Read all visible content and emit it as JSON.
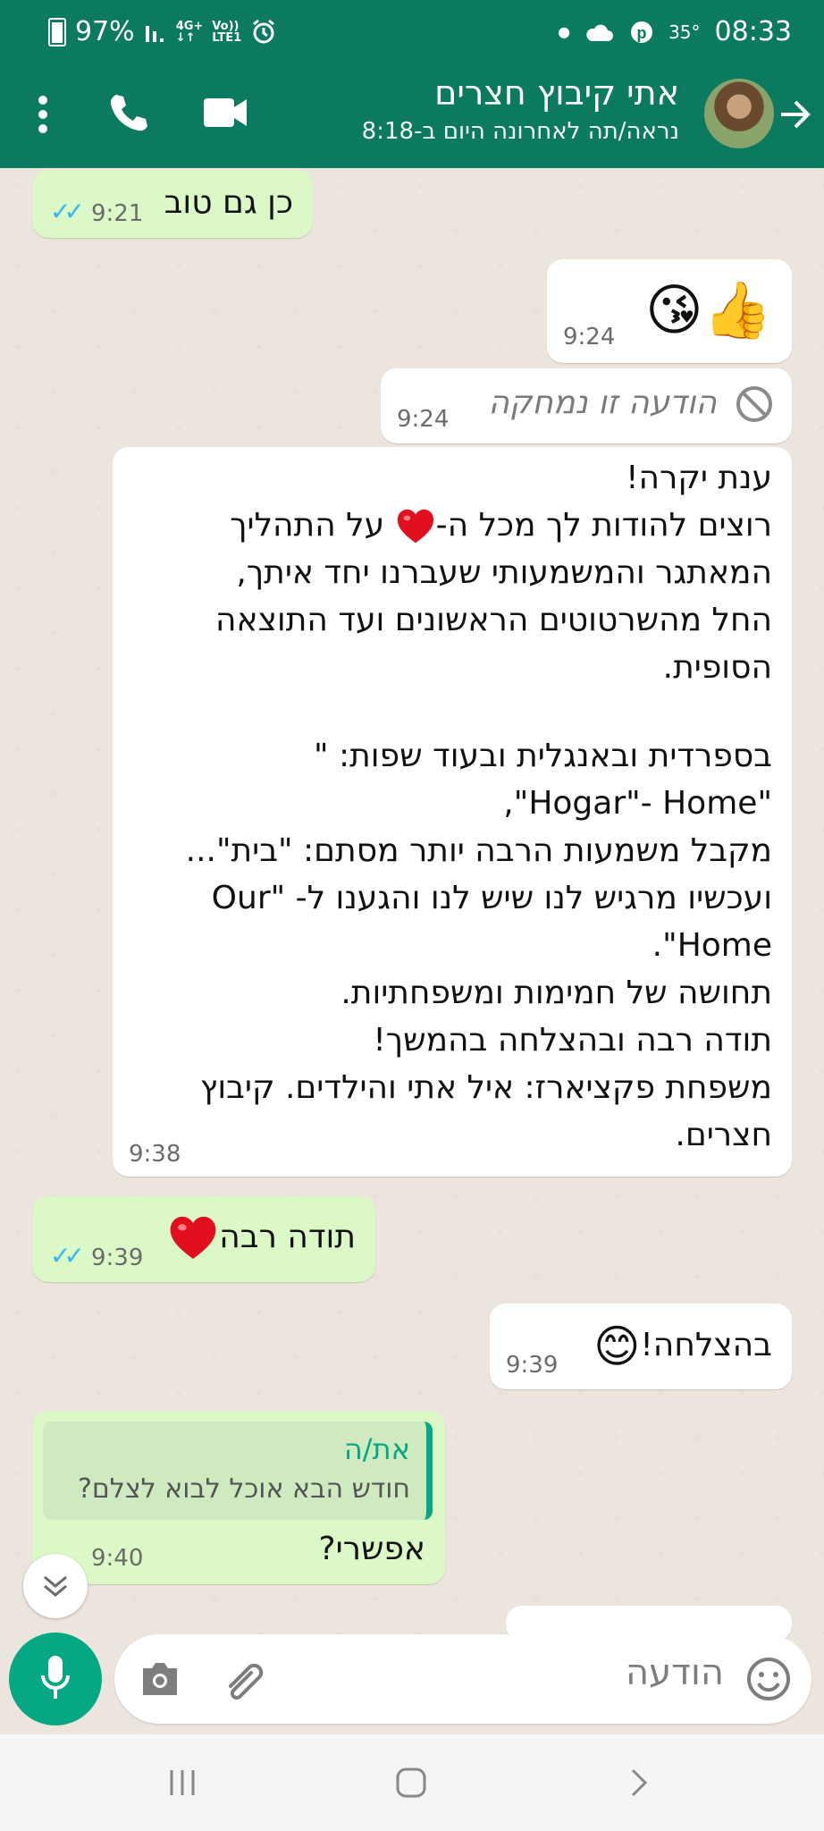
{
  "status_bar": {
    "battery": "97%",
    "network": "4G+",
    "network_line2": "LTE1",
    "volte": "Vo))",
    "temperature": "35°",
    "time": "08:33",
    "icons": [
      "battery-icon",
      "signal-icon",
      "alarm-icon",
      "dot-icon",
      "cloud-icon",
      "pinterest-icon"
    ]
  },
  "header": {
    "contact_name": "אתי קיבוץ חצרים",
    "last_seen": "נראה/תה לאחרונה היום ב-8:18",
    "icons": [
      "back-arrow-icon",
      "video-call-icon",
      "voice-call-icon",
      "more-options-icon"
    ]
  },
  "messages": [
    {
      "id": "m1",
      "dir": "out",
      "text": "כן גם טוב",
      "time": "9:21",
      "ticks": "read"
    },
    {
      "id": "m2",
      "dir": "in",
      "text": "👍😘",
      "time": "9:24"
    },
    {
      "id": "m3",
      "dir": "in",
      "text": "הודעה זו נמחקה",
      "time": "9:24",
      "deleted": true
    },
    {
      "id": "m4",
      "dir": "in",
      "time": "9:38",
      "lines": [
        "ענת יקרה!",
        "רוצים להודות לך מכל ה-",
        " על התהליך",
        "המאתגר והמשמעותי שעברנו יחד איתך,",
        "החל מהשרטוטים הראשונים ועד התוצאה",
        "הסופית.",
        "בספרדית ובאנגלית ובעוד שפות: \"",
        "\"Hogar\"- Home\",",
        "מקבל משמעות הרבה יותר מסתם: \"בית\"...",
        "ועכשיו מרגיש לנו שיש לנו והגענו ל- \"Our",
        "Home\".",
        "תחושה של חמימות ומשפחתיות.",
        "תודה רבה ובהצלחה בהמשך!",
        "משפחת פקציארז: איל אתי והילדים. קיבוץ",
        "חצרים."
      ]
    },
    {
      "id": "m5",
      "dir": "out",
      "text": "תודה רבה",
      "time": "9:39",
      "ticks": "read"
    },
    {
      "id": "m6",
      "dir": "in",
      "text": "בהצלחה!",
      "emoji": "😊",
      "time": "9:39"
    },
    {
      "id": "m7",
      "dir": "out",
      "quote_author": "את/ה",
      "quote_text": "חודש הבא אוכל לבוא לצלם?",
      "text": "אפשרי?",
      "time": "9:40"
    }
  ],
  "composer": {
    "placeholder": "הודעה"
  },
  "colors": {
    "header": "#0b7a5e",
    "accent": "#06a884",
    "outgoing_bubble": "#dcf8c6",
    "incoming_bubble": "#ffffff",
    "read_ticks": "#34b7f1"
  }
}
